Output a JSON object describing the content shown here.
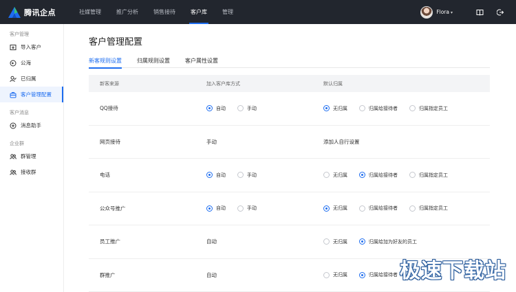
{
  "brand": {
    "name": "腾讯企点"
  },
  "nav": [
    {
      "label": "社媒管理",
      "active": false
    },
    {
      "label": "推广分析",
      "active": false
    },
    {
      "label": "销售接待",
      "active": false
    },
    {
      "label": "客户库",
      "active": true
    },
    {
      "label": "管理",
      "active": false
    }
  ],
  "user": {
    "name": "Flora",
    "caret": "▾"
  },
  "sidebar": {
    "groups": [
      {
        "title": "客户管理",
        "items": [
          {
            "label": "导入客户",
            "icon": "import-icon",
            "active": false
          },
          {
            "label": "公海",
            "icon": "globe-icon",
            "active": false
          },
          {
            "label": "已归属",
            "icon": "user-check-icon",
            "active": false
          },
          {
            "label": "客户管理配置",
            "icon": "briefcase-icon",
            "active": true
          }
        ]
      },
      {
        "title": "客户消息",
        "items": [
          {
            "label": "消息助手",
            "icon": "message-icon",
            "active": false
          }
        ]
      },
      {
        "title": "企业群",
        "items": [
          {
            "label": "群管理",
            "icon": "group-icon",
            "active": false
          },
          {
            "label": "接收群",
            "icon": "receive-group-icon",
            "active": false
          }
        ]
      }
    ]
  },
  "page": {
    "title": "客户管理配置",
    "tabs": [
      {
        "label": "新客规则设置",
        "active": true
      },
      {
        "label": "归属规则设置",
        "active": false
      },
      {
        "label": "客户属性设置",
        "active": false
      }
    ]
  },
  "table": {
    "headers": [
      "新客来源",
      "加入客户库方式",
      "默认归属"
    ],
    "rows": [
      {
        "source": "QQ接待",
        "join": {
          "type": "radio",
          "options": [
            {
              "label": "自动",
              "checked": true
            },
            {
              "label": "手动",
              "checked": false
            }
          ]
        },
        "owner": {
          "type": "radio",
          "options": [
            {
              "label": "无归属",
              "checked": true
            },
            {
              "label": "归属给接待者",
              "checked": false
            },
            {
              "label": "归属指定员工",
              "checked": false
            }
          ]
        }
      },
      {
        "source": "网页接待",
        "join": {
          "type": "text",
          "text": "手动"
        },
        "owner": {
          "type": "text",
          "text": "添加人自行设置"
        }
      },
      {
        "source": "电话",
        "join": {
          "type": "radio",
          "options": [
            {
              "label": "自动",
              "checked": true
            },
            {
              "label": "手动",
              "checked": false
            }
          ]
        },
        "owner": {
          "type": "radio",
          "options": [
            {
              "label": "无归属",
              "checked": false
            },
            {
              "label": "归属给接待者",
              "checked": true
            },
            {
              "label": "归属指定员工",
              "checked": false
            }
          ]
        }
      },
      {
        "source": "公众号推广",
        "join": {
          "type": "radio",
          "options": [
            {
              "label": "自动",
              "checked": true
            },
            {
              "label": "手动",
              "checked": false
            }
          ]
        },
        "owner": {
          "type": "radio",
          "options": [
            {
              "label": "无归属",
              "checked": true
            },
            {
              "label": "归属给接待者",
              "checked": false
            },
            {
              "label": "归属指定员工",
              "checked": false
            }
          ]
        }
      },
      {
        "source": "员工推广",
        "join": {
          "type": "text",
          "text": "自动"
        },
        "owner": {
          "type": "radio",
          "options": [
            {
              "label": "无归属",
              "checked": false
            },
            {
              "label": "归属给加为好友的员工",
              "checked": true
            }
          ]
        }
      },
      {
        "source": "群推广",
        "join": {
          "type": "text",
          "text": "自动"
        },
        "owner": {
          "type": "radio",
          "options": [
            {
              "label": "无归属",
              "checked": false
            },
            {
              "label": "归属给接待者",
              "checked": true
            }
          ]
        }
      }
    ]
  },
  "watermark": "极速下载站",
  "colors": {
    "accent": "#1d6df0",
    "topbar": "#22262e"
  }
}
